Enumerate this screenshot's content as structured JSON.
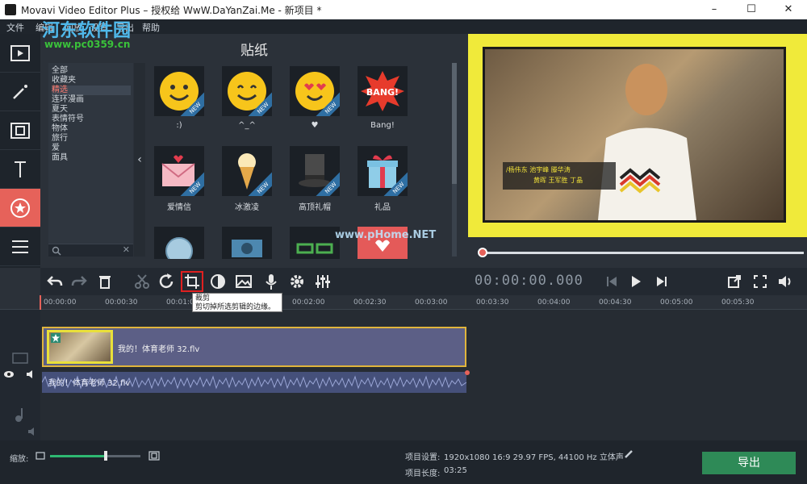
{
  "window": {
    "title": "Movavi Video Editor Plus – 授权给 WwW.DaYanZai.Me - 新项目 *"
  },
  "menu": [
    "文件",
    "编辑",
    "回放",
    "设置",
    "导出",
    "帮助"
  ],
  "watermark": {
    "site_cn": "河东软件园",
    "url": "www.pc0359.cn",
    "overlay": "www.pHome.NET"
  },
  "categories": {
    "items": [
      "全部",
      "收藏夹",
      "精选",
      "连环漫画",
      "夏天",
      "表情符号",
      "物体",
      "旅行",
      "爱",
      "面具"
    ],
    "selected": "精选"
  },
  "stickers": {
    "heading": "贴纸",
    "badge": "NEW",
    "items": [
      {
        "label": ":)"
      },
      {
        "label": "^_^"
      },
      {
        "label": "♥"
      },
      {
        "label": "Bang!",
        "art_text": "BANG!"
      },
      {
        "label": "爱情信"
      },
      {
        "label": "冰激凌"
      },
      {
        "label": "高顶礼帽"
      },
      {
        "label": "礼品"
      }
    ]
  },
  "preview": {
    "caption_line1": "/杨伟东 池宇峰 滕华涛",
    "caption_line2": "黄晖 王军胜 丁晶"
  },
  "playback": {
    "timecode": "00:00:00.000"
  },
  "tooltip": {
    "title": "裁剪",
    "text": "剪切掉所选剪辑的边缘。"
  },
  "ruler": {
    "ticks": [
      "00:00:00",
      "00:00:30",
      "00:01:0",
      "00:01:30",
      "00:02:00",
      "00:02:30",
      "00:03:00",
      "00:03:30",
      "00:04:00",
      "00:04:30",
      "00:05:00",
      "00:05:30"
    ]
  },
  "timeline": {
    "video_clip": "我的！体育老师 32.flv",
    "audio_clip": "我的！体育老师 32.flv"
  },
  "status": {
    "zoom_label": "缩放:",
    "zoom_level": 0.62,
    "settings_label": "项目设置:",
    "settings_value": "1920x1080 16:9 29.97 FPS, 44100 Hz 立体声",
    "length_label": "项目长度:",
    "length_value": "03:25",
    "export_label": "导出"
  },
  "colors": {
    "accent": "#e6625a",
    "export": "#2e8a57",
    "preview_bg": "#f0ea3a",
    "clip_border": "#e0b53c"
  }
}
